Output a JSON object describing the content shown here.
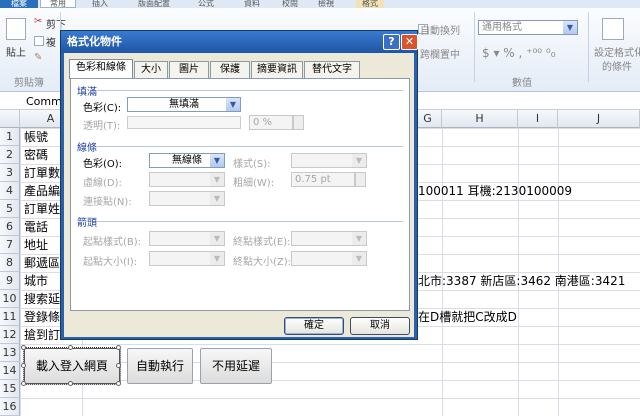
{
  "ribbon": {
    "tabs": {
      "file": "檔案",
      "home": "常用",
      "insert": "插入",
      "page_layout": "版面配置",
      "formulas": "公式",
      "data": "資料",
      "review": "校閱",
      "view": "檢視",
      "format": "格式"
    },
    "clipboard": {
      "paste": "貼上",
      "cut": "剪下",
      "copy": "複",
      "group": "剪貼簿"
    },
    "wrap_text": "自動換列",
    "merge_center": "跨欄置中",
    "number_format": "通用格式",
    "number_group": "數值",
    "cond_format": "設定格式化",
    "cond_format2": "的條件"
  },
  "formula_bar": {
    "name_box": "Comm"
  },
  "columns": [
    "A",
    "G",
    "H",
    "I",
    "J"
  ],
  "rows": [
    "1",
    "2",
    "3",
    "4",
    "5",
    "6",
    "7",
    "8",
    "9",
    "10",
    "11",
    "12",
    "13",
    "14",
    "15",
    "16"
  ],
  "cells": {
    "a1": "帳號",
    "a2": "密碼",
    "a3": "訂單數",
    "a4": "產品編",
    "a5": "訂單姓",
    "a6": "電話",
    "a7": "地址",
    "a8": "郵遞區",
    "a9": "城市",
    "a10": "搜索延",
    "a11": "登錄條",
    "a12": "搶到訂",
    "g4": "100011  耳機:2130100009",
    "g9": "北市:3387 新店區:3462 南港區:3421",
    "g11": "在D槽就把C改成D"
  },
  "sheet_buttons": {
    "load": "載入登入網頁",
    "auto": "自動執行",
    "nodelay": "不用延遲"
  },
  "dialog": {
    "title": "格式化物件",
    "help": "?",
    "close": "✕",
    "tabs": [
      "色彩和線條",
      "大小",
      "圖片",
      "保護",
      "摘要資訊",
      "替代文字"
    ],
    "fill": {
      "section": "填滿",
      "color_label": "色彩(C):",
      "color_value": "無填滿",
      "transparency_label": "透明(T):",
      "transparency_value": "0 %"
    },
    "line": {
      "section": "線條",
      "color_label": "色彩(O):",
      "color_value": "無線條",
      "style_label": "樣式(S):",
      "dashed_label": "虛線(D):",
      "weight_label": "粗細(W):",
      "weight_value": "0.75 pt",
      "connector_label": "連接點(N):"
    },
    "arrows": {
      "section": "箭頭",
      "begin_style": "起點樣式(B):",
      "end_style": "終點樣式(E):",
      "begin_size": "起點大小(I):",
      "end_size": "終點大小(Z):"
    },
    "ok": "確定",
    "cancel": "取消"
  }
}
